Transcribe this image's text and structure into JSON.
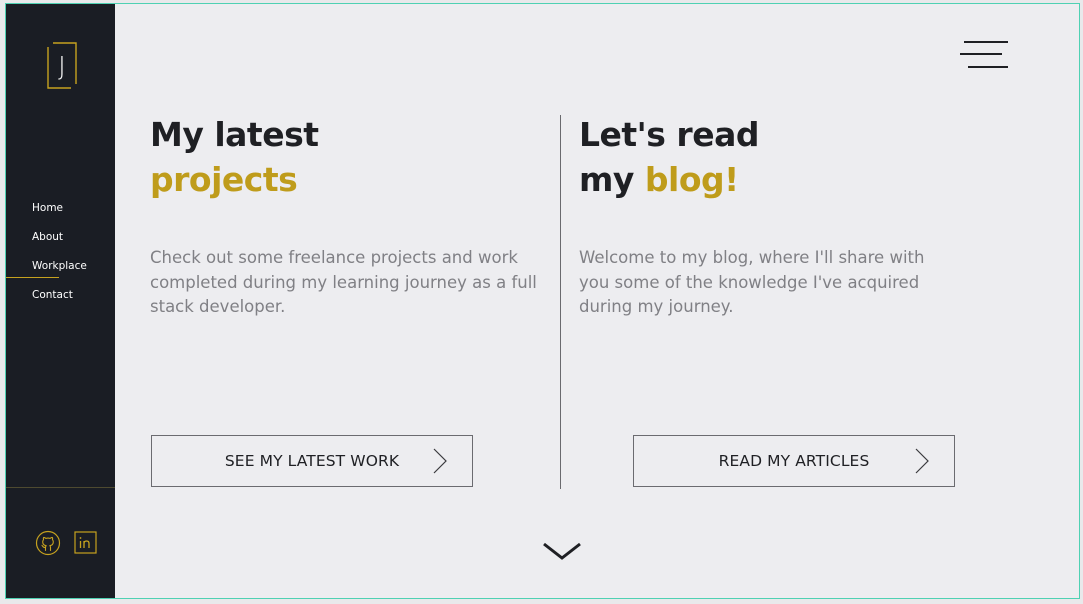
{
  "brand": {
    "logo_letter": "J",
    "accent_color": "#bf9c1b",
    "sidebar_color": "#1a1d24"
  },
  "sidebar": {
    "nav": [
      {
        "label": "Home",
        "active": false
      },
      {
        "label": "About",
        "active": false
      },
      {
        "label": "Workplace",
        "active": true
      },
      {
        "label": "Contact",
        "active": false
      }
    ],
    "social": [
      {
        "icon": "github-icon"
      },
      {
        "icon": "linkedin-icon"
      }
    ]
  },
  "header": {
    "menu_icon": "hamburger-menu-icon"
  },
  "projects": {
    "heading_line1": "My latest",
    "heading_accent": "projects",
    "description": "Check out some freelance projects and work completed during my learning journey as a full stack developer.",
    "button_label": "SEE MY LATEST WORK"
  },
  "blog": {
    "heading_line1": "Let's read",
    "heading_line2_prefix": "my ",
    "heading_accent": "blog!",
    "description": "Welcome to my blog, where I'll share with you some of the knowledge I've acquired during my journey.",
    "button_label": "READ MY ARTICLES"
  },
  "footer": {
    "scroll_icon": "chevron-down-icon"
  }
}
